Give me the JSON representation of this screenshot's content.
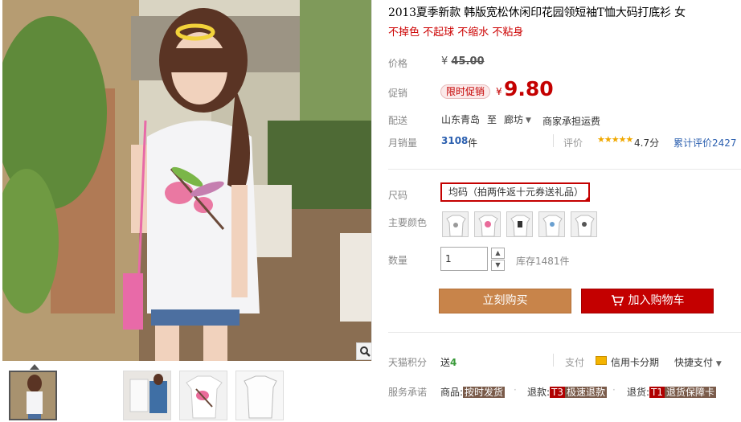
{
  "product": {
    "title": "2013夏季新款 韩版宽松休闲印花园领短袖T恤大码打底衫 女",
    "subtitle": "不掉色 不起球 不缩水 不粘身"
  },
  "price": {
    "label": "价格",
    "currency": "¥",
    "original": "45.00",
    "promo_label": "促销",
    "promo_tag": "限时促销",
    "promo": "9.80"
  },
  "shipping": {
    "label": "配送",
    "from": "山东青岛",
    "to_word": "至",
    "to": "廊坊",
    "fee": "商家承担运费"
  },
  "sales": {
    "label": "月销量",
    "count": "3108",
    "unit": "件",
    "rating_label": "评价",
    "stars": "★★★★★",
    "score": "4.7分",
    "reviews": "累计评价2427"
  },
  "options": {
    "size_label": "尺码",
    "size_value": "均码（拍两件返十元券送礼品）",
    "color_label": "主要颜色",
    "quantity_label": "数量",
    "quantity": "1",
    "stock": "库存1481件"
  },
  "actions": {
    "buy_now": "立刻购买",
    "add_cart": "加入购物车"
  },
  "extras": {
    "points_label": "天猫积分",
    "points_prefix": "送",
    "points_value": "4",
    "pay_label": "支付",
    "credit": "信用卡分期",
    "quick_pay": "快捷支付",
    "service_label": "服务承诺",
    "svc1_prefix": "商品:",
    "svc1_tag": "按时发货",
    "svc2_prefix": "退款:",
    "svc2_code": "T3",
    "svc2_tag": "极速退款",
    "svc3_prefix": "退货:",
    "svc3_code": "T1",
    "svc3_tag": "退货保障卡"
  },
  "colors": {
    "accent_red": "#c40000",
    "buy_orange": "#c8844a",
    "link_blue": "#2b5faf"
  },
  "icons": [
    "magnifier-icon",
    "cart-icon",
    "credit-card-icon",
    "chevron-down-icon",
    "star-icon"
  ]
}
